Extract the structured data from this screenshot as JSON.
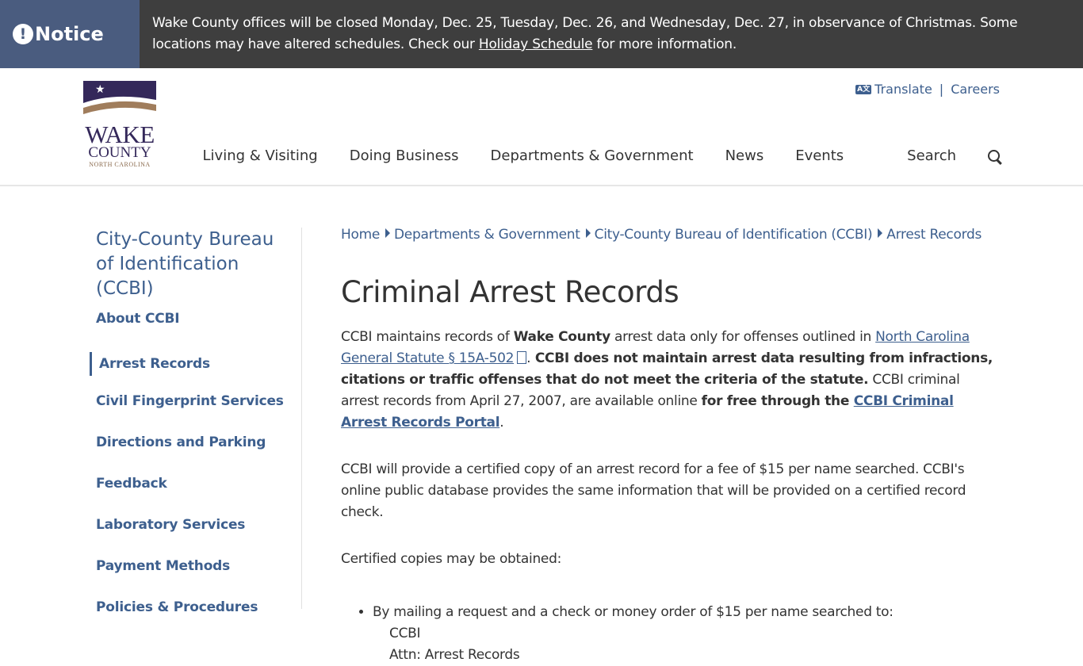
{
  "notice": {
    "label": "Notice",
    "text_before": "Wake County offices will be closed Monday, Dec. 25, Tuesday, Dec. 26, and Wednesday, Dec. 27, in observance of Christmas. Some locations may have altered schedules. Check our ",
    "link": "Holiday Schedule",
    "text_after": " for more information."
  },
  "logo": {
    "line1": "WAKE",
    "line2": "COUNTY",
    "line3": "NORTH CAROLINA"
  },
  "utility": {
    "translate": "Translate",
    "sep": "|",
    "careers": "Careers"
  },
  "nav": {
    "items": [
      "Living & Visiting",
      "Doing Business",
      "Departments & Government",
      "News",
      "Events"
    ],
    "search": "Search"
  },
  "sidebar": {
    "title": "City-County Bureau of Identification (CCBI)",
    "items": [
      "About CCBI",
      "Arrest Records",
      "Civil Fingerprint Services",
      "Directions and Parking",
      "Feedback",
      "Laboratory Services",
      "Payment Methods",
      "Policies & Procedures"
    ]
  },
  "breadcrumb": [
    "Home",
    "Departments & Government",
    "City-County Bureau of Identification (CCBI)",
    "Arrest Records"
  ],
  "page": {
    "title": "Criminal Arrest Records",
    "p1": {
      "t1": "CCBI maintains records of ",
      "b1": "Wake County",
      "t2": " arrest data only for offenses outlined in ",
      "link1": "North Carolina General Statute § 15A-502",
      "b2": " CCBI does not maintain arrest data resulting from infractions, citations or traffic offenses that do not meet the criteria of the statute.",
      "t3": " CCBI criminal arrest records from April 27, 2007, are available online ",
      "b3": "for free through the ",
      "link2": "CCBI Criminal Arrest Records Portal",
      "t4": "."
    },
    "p2": "CCBI will provide a certified copy of an arrest record for a fee of $15 per name searched. CCBI's online public database provides the same information that will be provided on a certified record check.",
    "p3": "Certified copies may be obtained:",
    "list_item": "By mailing a request and a check or money order of $15 per name searched to:",
    "addr1": "CCBI",
    "addr2": "Attn: Arrest Records"
  }
}
